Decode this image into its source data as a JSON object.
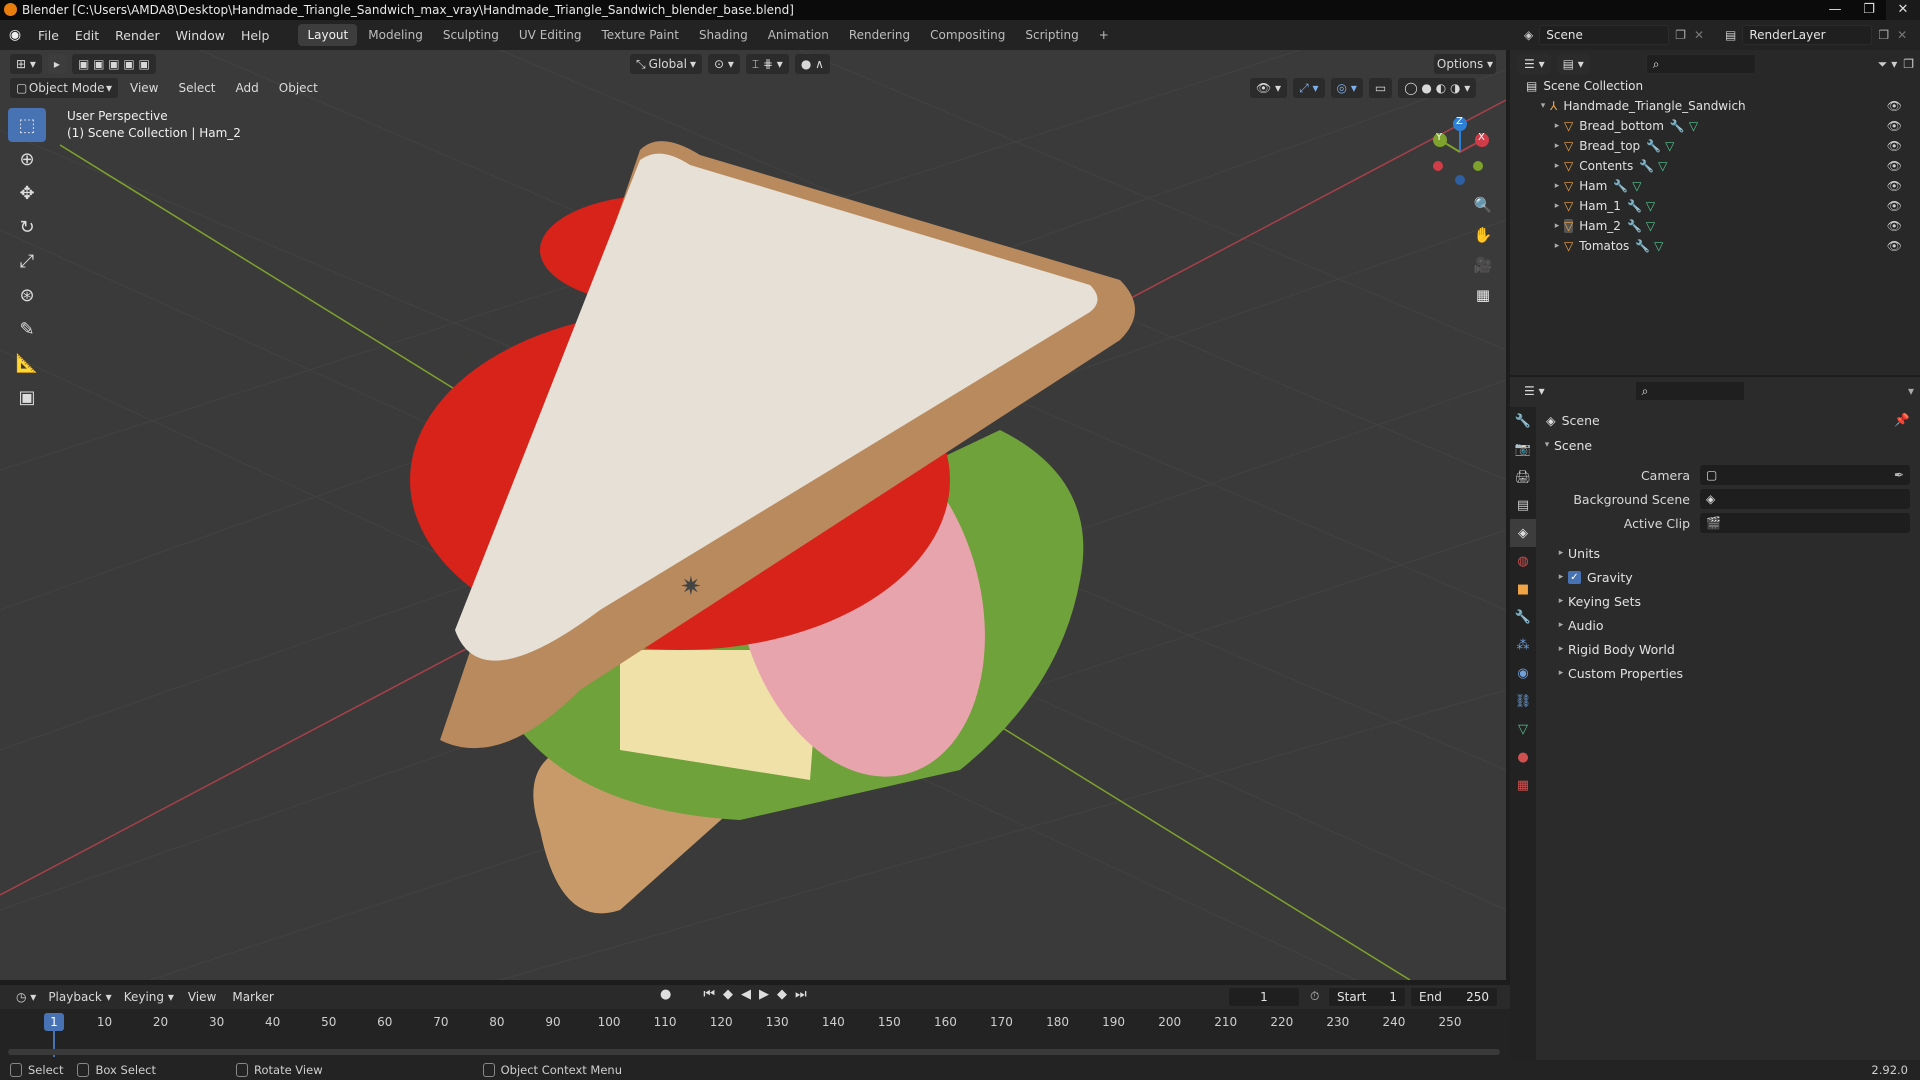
{
  "window": {
    "title": "Blender [C:\\Users\\AMDA8\\Desktop\\Handmade_Triangle_Sandwich_max_vray\\Handmade_Triangle_Sandwich_blender_base.blend]",
    "controls": [
      "—",
      "❐",
      "✕"
    ]
  },
  "menubar": {
    "menus": [
      "File",
      "Edit",
      "Render",
      "Window",
      "Help"
    ],
    "workspaces": [
      "Layout",
      "Modeling",
      "Sculpting",
      "UV Editing",
      "Texture Paint",
      "Shading",
      "Animation",
      "Rendering",
      "Compositing",
      "Scripting"
    ],
    "add_workspace": "+",
    "scene": "Scene",
    "view_layer": "RenderLayer"
  },
  "viewport": {
    "transform_orientation": "Global",
    "options_label": "Options",
    "mode": "Object Mode",
    "menus": [
      "View",
      "Select",
      "Add",
      "Object"
    ],
    "perspective": "User Perspective",
    "collection_info": "(1) Scene Collection | Ham_2",
    "gizmo": {
      "x": "X",
      "y": "Y",
      "z": "Z"
    },
    "colors": {
      "x_axis": "#a8404a",
      "y_axis": "#7ea22c",
      "z_axis": "#2e7fd6",
      "background": "#3a3a3a"
    }
  },
  "outliner": {
    "root": "Scene Collection",
    "collection": "Handmade_Triangle_Sandwich",
    "objects": [
      "Bread_bottom",
      "Bread_top",
      "Contents",
      "Ham",
      "Ham_1",
      "Ham_2",
      "Tomatos"
    ]
  },
  "properties": {
    "context": "Scene",
    "panel_title": "Scene",
    "fields": [
      {
        "label": "Camera",
        "value": ""
      },
      {
        "label": "Background Scene",
        "value": ""
      },
      {
        "label": "Active Clip",
        "value": ""
      }
    ],
    "subpanels": [
      "Units",
      "Gravity",
      "Keying Sets",
      "Audio",
      "Rigid Body World",
      "Custom Properties"
    ],
    "gravity_checked": true
  },
  "timeline": {
    "menus": [
      "Playback",
      "Keying",
      "View",
      "Marker"
    ],
    "current_frame": "1",
    "start_label": "Start",
    "start": "1",
    "end_label": "End",
    "end": "250",
    "ticks": [
      "1",
      "10",
      "20",
      "30",
      "40",
      "50",
      "60",
      "70",
      "80",
      "90",
      "100",
      "110",
      "120",
      "130",
      "140",
      "150",
      "160",
      "170",
      "180",
      "190",
      "200",
      "210",
      "220",
      "230",
      "240",
      "250"
    ]
  },
  "statusbar": {
    "select": "Select",
    "box_select": "Box Select",
    "rotate_view": "Rotate View",
    "context_menu": "Object Context Menu",
    "version": "2.92.0"
  }
}
